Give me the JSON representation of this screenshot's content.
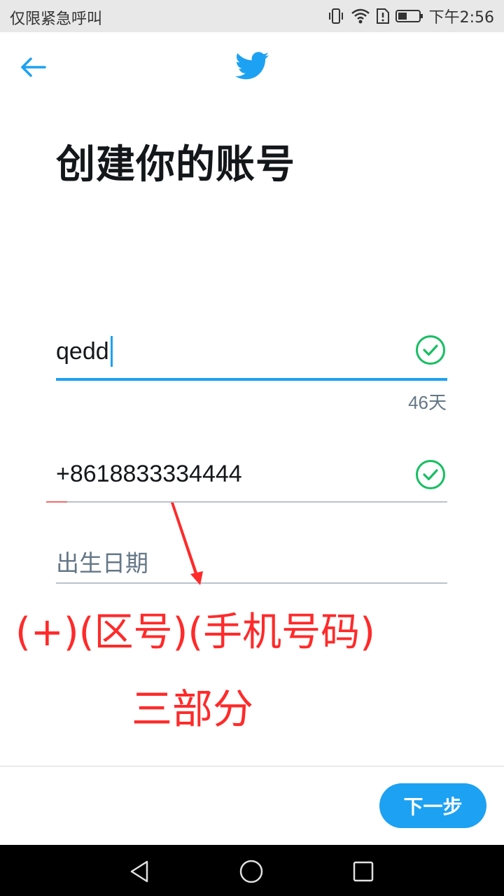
{
  "status_bar": {
    "carrier": "仅限紧急呼叫",
    "time": "下午2:56",
    "icons": [
      "vibrate-icon",
      "wifi-icon",
      "sim-alert-icon",
      "battery-icon"
    ]
  },
  "header": {
    "back_icon": "arrow-left-icon",
    "logo_icon": "twitter-bird-icon"
  },
  "page": {
    "title": "创建你的账号"
  },
  "form": {
    "name": {
      "value": "qedd",
      "valid": true,
      "counter": "46天"
    },
    "phone": {
      "value": "+8618833334444",
      "valid": true
    },
    "birthday": {
      "placeholder": "出生日期"
    }
  },
  "annotations": {
    "format": "(+)(区号)(手机号码)",
    "parts": "三部分"
  },
  "footer": {
    "next_label": "下一步"
  },
  "colors": {
    "accent": "#1da1f2",
    "valid_green": "#17bf63",
    "annotation_red": "#ff2a2a",
    "title_text": "#14171a",
    "muted_text": "#657786"
  }
}
